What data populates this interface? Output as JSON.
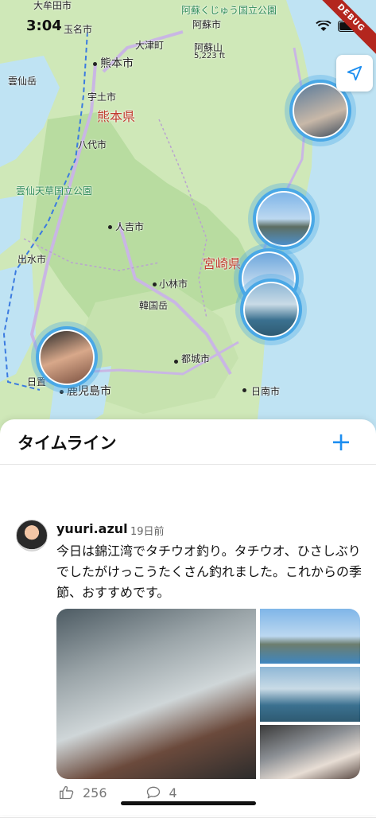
{
  "status_bar": {
    "time": "3:04",
    "debug_label": "DEBUG"
  },
  "map": {
    "labels": {
      "kumamoto_city": "熊本市",
      "ozu": "大津町",
      "aso_park": "阿蘇くじゅう国立公園",
      "aso_city": "阿蘇市",
      "aso_san": "阿蘇山",
      "aso_height": "5,223 ft",
      "unzen": "雲仙岳",
      "uto": "宇土市",
      "kumamoto_pref": "熊本県",
      "yatsushiro": "八代市",
      "unzen_amakusa_park": "雲仙天草国立公園",
      "hitoyoshi": "人吉市",
      "izumi": "出水市",
      "miyazaki_pref": "宮崎県",
      "kobayashi": "小林市",
      "karakunidake": "韓国岳",
      "miyakonojo": "都城市",
      "kagoshima_city": "鹿児島市",
      "hioki": "日置",
      "nichinan": "日南市",
      "tamana": "玉名市",
      "omuta": "大牟田市"
    }
  },
  "timeline": {
    "title": "タイムライン",
    "add_label": "+",
    "post": {
      "username": "yuuri.azul",
      "ago": "19日前",
      "text": "今日は錦江湾でタチウオ釣り。タチウオ、ひさしぶりでしたがけっこうたくさん釣れました。これからの季節、おすすめです。",
      "likes": "256",
      "comments": "4"
    }
  }
}
